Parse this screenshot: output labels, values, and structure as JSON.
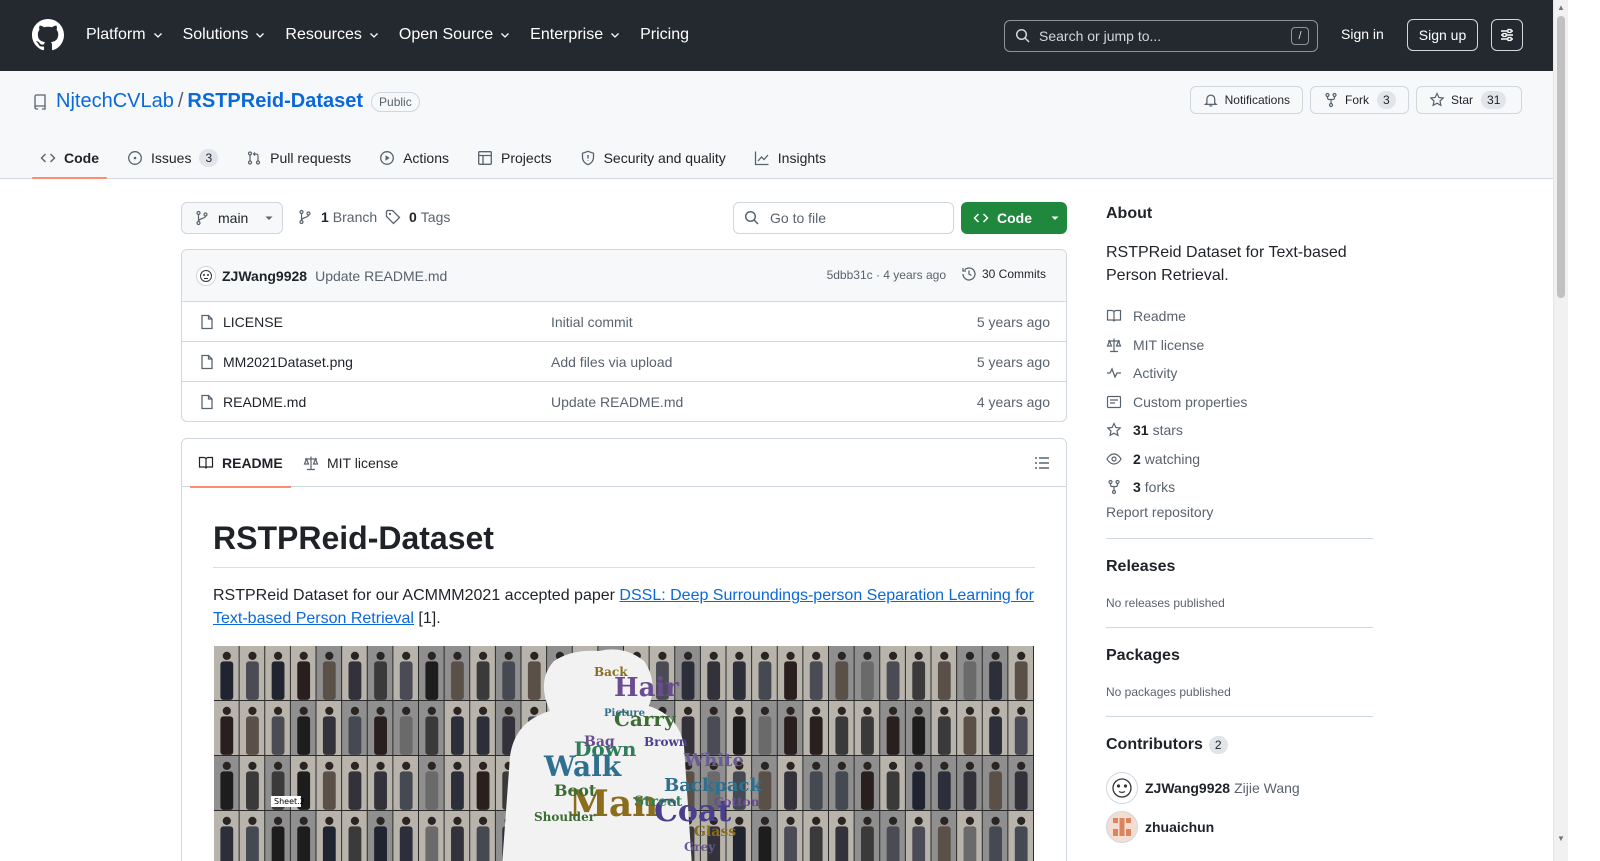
{
  "header": {
    "nav": [
      "Platform",
      "Solutions",
      "Resources",
      "Open Source",
      "Enterprise",
      "Pricing"
    ],
    "search_placeholder": "Search or jump to...",
    "search_kbd": "/",
    "sign_in": "Sign in",
    "sign_up": "Sign up"
  },
  "repo": {
    "owner": "NjtechCVLab",
    "separator": "/",
    "name": "RSTPReid-Dataset",
    "visibility": "Public",
    "notifications_label": "Notifications",
    "fork_label": "Fork",
    "fork_count": "3",
    "star_label": "Star",
    "star_count": "31",
    "tabs": [
      {
        "label": "Code",
        "icon": "code-icon"
      },
      {
        "label": "Issues",
        "icon": "issue-icon",
        "count": "3"
      },
      {
        "label": "Pull requests",
        "icon": "pull-request-icon"
      },
      {
        "label": "Actions",
        "icon": "play-icon"
      },
      {
        "label": "Projects",
        "icon": "table-icon"
      },
      {
        "label": "Security and quality",
        "icon": "shield-icon"
      },
      {
        "label": "Insights",
        "icon": "graph-icon"
      }
    ]
  },
  "toolbar": {
    "branch": "main",
    "branch_count": "1",
    "branch_label": "Branch",
    "tag_count": "0",
    "tag_label": "Tags",
    "goto_placeholder": "Go to file",
    "code_button": "Code"
  },
  "latest_commit": {
    "author": "ZJWang9928",
    "message": "Update README.md",
    "hash_age": "5dbb31c · 4 years ago",
    "commits": "30 Commits"
  },
  "files": [
    {
      "name": "LICENSE",
      "message": "Initial commit",
      "age": "5 years ago"
    },
    {
      "name": "MM2021Dataset.png",
      "message": "Add files via upload",
      "age": "5 years ago"
    },
    {
      "name": "README.md",
      "message": "Update README.md",
      "age": "4 years ago"
    }
  ],
  "readme": {
    "tab_readme": "README",
    "tab_license": "MIT license",
    "title": "RSTPReid-Dataset",
    "intro_prefix": "RSTPReid Dataset for our ACMMM2021 accepted paper ",
    "intro_link": "DSSL: Deep Surroundings-person Separation Learning for Text-based Person Retrieval",
    "intro_suffix": " [1].",
    "figure_words": [
      "Hair",
      "Carry",
      "Walk",
      "Man",
      "Coat",
      "Down",
      "White",
      "Bag",
      "Boot",
      "Backpack",
      "Glass",
      "Brown",
      "Street",
      "Grey",
      "Cotton",
      "Shoulder",
      "Picture",
      "Back"
    ],
    "figure_label": "Sheet.2"
  },
  "sidebar": {
    "about_title": "About",
    "description": "RSTPReid Dataset for Text-based Person Retrieval.",
    "links": {
      "readme": "Readme",
      "license": "MIT license",
      "activity": "Activity",
      "custom_properties": "Custom properties",
      "stars_count": "31",
      "stars_label": "stars",
      "watching_count": "2",
      "watching_label": "watching",
      "forks_count": "3",
      "forks_label": "forks"
    },
    "report": "Report repository",
    "releases_title": "Releases",
    "releases_empty": "No releases published",
    "packages_title": "Packages",
    "packages_empty": "No packages published",
    "contributors_title": "Contributors",
    "contributors_count": "2",
    "contributors": [
      {
        "login": "ZJWang9928",
        "name": "Zijie Wang"
      },
      {
        "login": "zhuaichun",
        "name": ""
      }
    ]
  },
  "colors": {
    "header_bg": "#24292f",
    "link": "#0969da",
    "primary_button": "#1f883d",
    "tab_underline": "#fd8c73"
  }
}
